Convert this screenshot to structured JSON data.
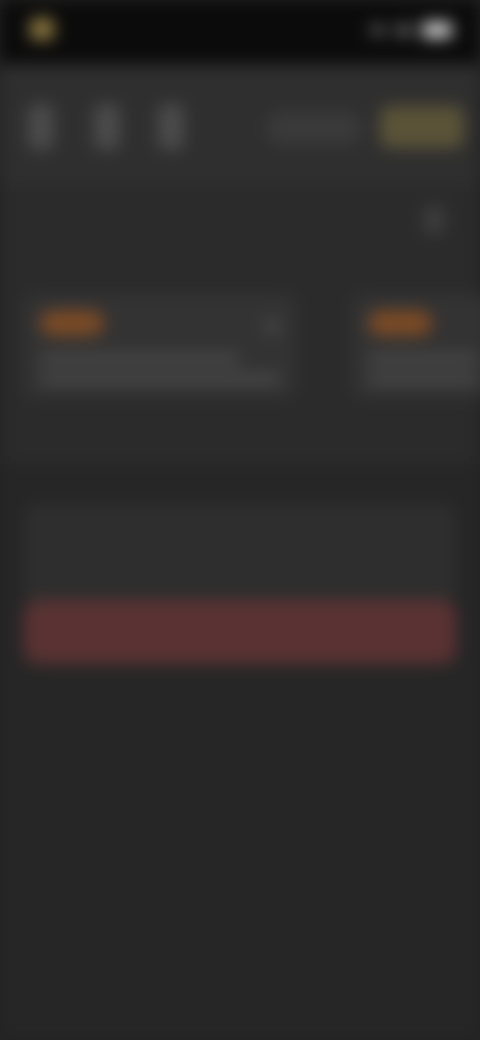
{
  "status_bar": {
    "brand_text": "",
    "icons": [
      "signal-icon",
      "wifi-icon",
      "battery-icon"
    ]
  },
  "toolbar": {
    "icons": [
      "tool-icon-1",
      "tool-icon-2",
      "tool-icon-3"
    ],
    "add_label": "",
    "primary_label": ""
  },
  "section": {
    "title": "",
    "subtitle": "",
    "cards": [
      {
        "title": ""
      },
      {
        "title": ""
      }
    ]
  },
  "actions": {
    "panel_label": "",
    "danger_label": ""
  },
  "colors": {
    "background": "#232323",
    "accent_gold": "#5a5338",
    "danger": "#5a3233",
    "badge_orange": "#7a4a26"
  }
}
